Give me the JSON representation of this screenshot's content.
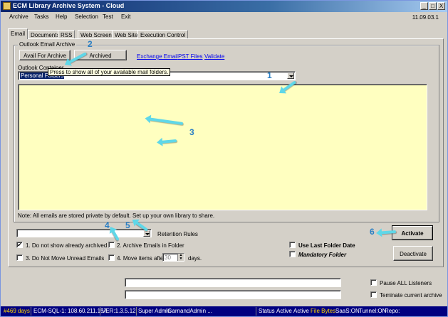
{
  "window": {
    "title": "ECM Library Archive System - Cloud",
    "version": "11.09.03.1"
  },
  "menu": [
    "Archive",
    "Tasks",
    "Help",
    "Selection",
    "Test",
    "Exit"
  ],
  "window_buttons": [
    "_",
    "□",
    "X"
  ],
  "tabs": [
    "Email",
    "Documents",
    "RSS",
    "Web Screen",
    "Web Site",
    "Execution Control"
  ],
  "group": {
    "title": "Outlook Email Archive"
  },
  "buttons": {
    "avail": "Avail For Archive",
    "archived": "Archived",
    "activate": "Activate",
    "deactivate": "Deactivate"
  },
  "links": {
    "exchange": "Exchange Email",
    "pst": "PST Files",
    "validate": "Validate"
  },
  "tooltip": "Press to show all of your available mail folders.",
  "container": {
    "label": "Outlook Container",
    "value": "Personal Folders"
  },
  "note": "Note: All emails are stored private by default. Set up your own library to share.",
  "retention": {
    "label": "Retention Rules",
    "value": ""
  },
  "options": {
    "opt1": {
      "label": "1. Do not show already archived",
      "checked": true
    },
    "opt2": {
      "label": "2. Archive Emails in Folder",
      "checked": false
    },
    "opt3": {
      "label": "3. Do Not Move Unread Emails",
      "checked": false
    },
    "opt4": {
      "label": "4. Move items after",
      "checked": false
    },
    "days_value": "30",
    "days_label": "days.",
    "last_date": {
      "label": "Use Last Folder Date",
      "checked": false
    },
    "mandatory": {
      "label": "Mandatory Folder",
      "checked": false
    }
  },
  "listeners": {
    "pause": "Pause ALL Listeners",
    "terminate": "Teminate current archive"
  },
  "status": {
    "days": "#469 days",
    "server": "ECM-SQL-1: 108.60.211.157",
    "ver": "VER:1.3.5.12",
    "role": "Super Admin",
    "user": "IGarnandAdmin ...",
    "status": "Status",
    "active1": "Active",
    "active2": "Active",
    "filebytes": "File Bytes",
    "saas": "SaaS:ON",
    "tunnel": "Tunnel:ON",
    "repo": "Repo:"
  },
  "callouts": [
    "1",
    "2",
    "3",
    "4",
    "5",
    "6"
  ],
  "colors": {
    "list_bg": "#ffffc0",
    "arrow": "#5fd7e8",
    "callout": "#2a7fc4",
    "status_bg": "#000080"
  }
}
